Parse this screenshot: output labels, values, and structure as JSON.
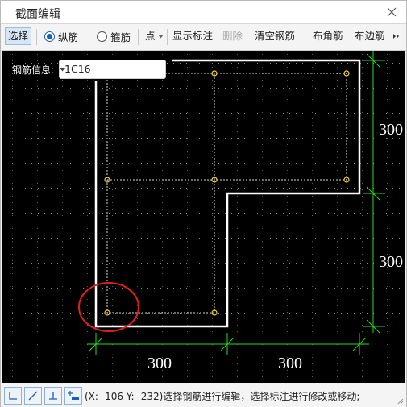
{
  "window": {
    "title": "截面编辑",
    "close_icon": "close-icon"
  },
  "toolbar": {
    "select_label": "选择",
    "longitudinal_label": "纵筋",
    "stirrup_label": "箍筋",
    "point_label": "点",
    "show_dims_label": "显示标注",
    "delete_label": "删除",
    "clear_rebar_label": "清空钢筋",
    "corner_rebar_label": "布角筋",
    "side_rebar_label": "布边筋",
    "more_icon": "double-chevron-right-icon",
    "longitudinal_checked": true
  },
  "rebar_info": {
    "label": "钢筋信息:",
    "value": "1C16"
  },
  "dimensions": {
    "right_top": "300",
    "right_bottom": "300",
    "bottom_left": "300",
    "bottom_right": "300"
  },
  "status": {
    "text": "(X: -106 Y: -232)选择钢筋进行编辑，选择标注进行修改或移动;"
  },
  "colors": {
    "canvas_bg": "#000000",
    "section_outline": "#ffffff",
    "rebar_point": "#ffd42a",
    "dimension": "#22dd22",
    "highlight_circle": "#e02020",
    "grid": "#8a8a8a"
  }
}
